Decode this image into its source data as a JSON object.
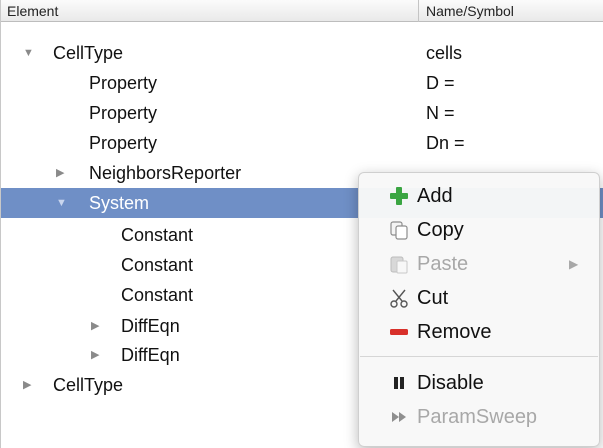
{
  "header": {
    "col_element": "Element",
    "col_name": "Name/Symbol"
  },
  "rows": [
    {
      "disc": "▼",
      "label": "CellType",
      "value": "cells"
    },
    {
      "disc": "",
      "label": "Property",
      "value": "D ="
    },
    {
      "disc": "",
      "label": "Property",
      "value": "N ="
    },
    {
      "disc": "",
      "label": "Property",
      "value": "Dn ="
    },
    {
      "disc": "▶",
      "label": "NeighborsReporter",
      "value": ""
    },
    {
      "disc": "▼",
      "label": "System",
      "value": ""
    },
    {
      "disc": "",
      "label": "Constant",
      "value": ""
    },
    {
      "disc": "",
      "label": "Constant",
      "value": ""
    },
    {
      "disc": "",
      "label": "Constant",
      "value": ""
    },
    {
      "disc": "▶",
      "label": "DiffEqn",
      "value": ""
    },
    {
      "disc": "▶",
      "label": "DiffEqn",
      "value": ""
    },
    {
      "disc": "▶",
      "label": "CellType",
      "value": ""
    }
  ],
  "context_menu": {
    "add": "Add",
    "copy": "Copy",
    "paste": "Paste",
    "cut": "Cut",
    "remove": "Remove",
    "disable": "Disable",
    "param_sweep": "ParamSweep",
    "icons": {
      "add": "plus-icon",
      "copy": "copy-icon",
      "paste": "paste-icon",
      "cut": "scissors-icon",
      "remove": "minus-icon",
      "disable": "pause-icon",
      "param_sweep": "fast-forward-icon"
    },
    "colors": {
      "add": "#3aa542",
      "remove": "#d8302a",
      "selection": "#6f8fc6"
    }
  }
}
